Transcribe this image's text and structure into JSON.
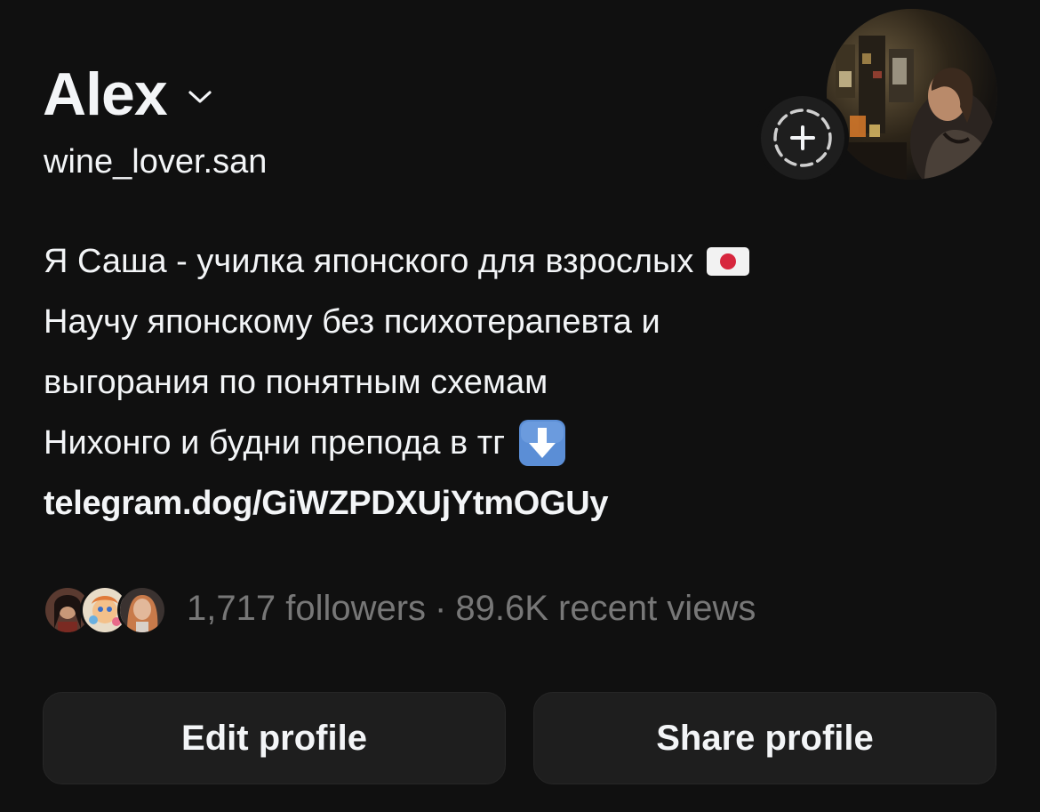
{
  "profile": {
    "display_name": "Alex",
    "username": "wine_lover.san",
    "bio_lines": [
      "Я Саша - училка японского для взрослых",
      "Научу японскому без психотерапевта и",
      "выгорания по понятным схемам",
      "Нихонго и будни препода в тг"
    ],
    "bio_link": "telegram.dog/GiWZPDXUjYtmOGUy"
  },
  "icons": {
    "name_dropdown": "chevron-down-icon",
    "add_story": "plus-circle-dashed-icon",
    "flag": "japan-flag-emoji",
    "down_arrow": "down-arrow-emoji"
  },
  "stats": {
    "followers": "1,717 followers",
    "separator": "·",
    "views": "89.6K recent views"
  },
  "buttons": {
    "edit_profile": "Edit profile",
    "share_profile": "Share profile"
  },
  "colors": {
    "background": "#101010",
    "primary_text": "#f3f5f7",
    "secondary_text": "#777777",
    "button_background": "#1e1e1e"
  }
}
